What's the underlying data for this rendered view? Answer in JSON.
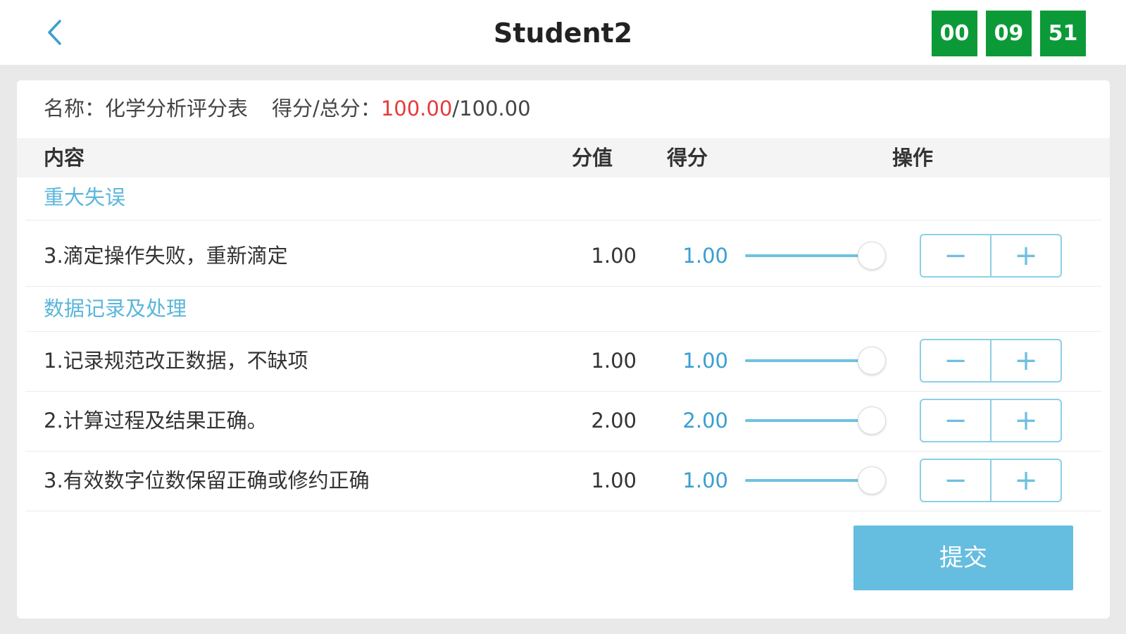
{
  "header": {
    "title": "Student2",
    "timer": {
      "hours": "00",
      "minutes": "09",
      "seconds": "51"
    }
  },
  "sheet": {
    "name_label": "名称：",
    "name": "化学分析评分表",
    "score_label": "得分/总分：",
    "score": "100.00",
    "total": "/100.00"
  },
  "table": {
    "columns": {
      "content": "内容",
      "value": "分值",
      "score": "得分",
      "action": "操作"
    }
  },
  "sections": [
    {
      "label": "重大失误",
      "items": [
        {
          "name": "3.滴定操作失败，重新滴定",
          "value": "1.00",
          "score": "1.00",
          "slider": 1.0
        }
      ]
    },
    {
      "label": "数据记录及处理",
      "items": [
        {
          "name": "1.记录规范改正数据，不缺项",
          "value": "1.00",
          "score": "1.00",
          "slider": 1.0
        },
        {
          "name": "2.计算过程及结果正确。",
          "value": "2.00",
          "score": "2.00",
          "slider": 1.0
        },
        {
          "name": "3.有效数字位数保留正确或修约正确",
          "value": "1.00",
          "score": "1.00",
          "slider": 1.0
        }
      ]
    }
  ],
  "stepper": {
    "minus": "−",
    "plus": "+"
  },
  "submit_label": "提交",
  "colors": {
    "timer": "#0c9a38",
    "accent": "#5bb6da",
    "score_red": "#e8393a"
  }
}
